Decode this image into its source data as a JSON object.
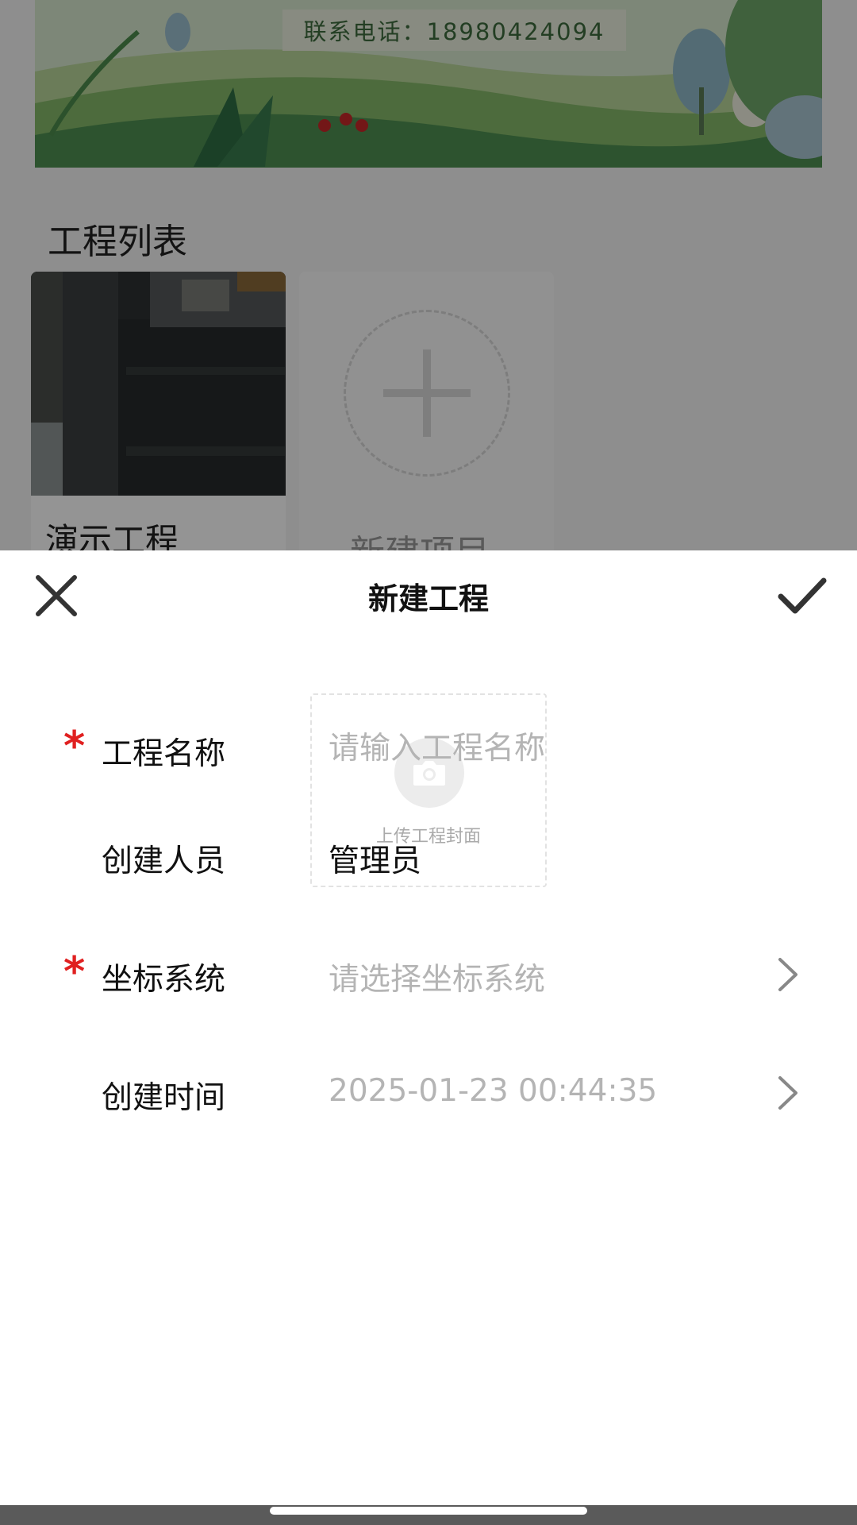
{
  "background": {
    "banner_phone": "联系电话：18980424094",
    "section_title": "工程列表",
    "projects": [
      {
        "name": "演示工程"
      }
    ],
    "new_project_label": "新建项目"
  },
  "sheet": {
    "title": "新建工程",
    "close_icon": "close-icon",
    "confirm_icon": "check-icon",
    "upload": {
      "label": "上传工程封面",
      "icon": "camera-icon"
    },
    "fields": {
      "project_name": {
        "label": "工程名称",
        "required": true,
        "placeholder": "请输入工程名称",
        "value": ""
      },
      "creator": {
        "label": "创建人员",
        "required": false,
        "value": "管理员"
      },
      "coordinate_system": {
        "label": "坐标系统",
        "required": true,
        "placeholder": "请选择坐标系统"
      },
      "created_time": {
        "label": "创建时间",
        "required": false,
        "value": "2025-01-23 00:44:35"
      }
    },
    "required_marker": "*"
  },
  "colors": {
    "required": "#e02020",
    "placeholder": "#b4b4b4",
    "overlay": "rgba(0,0,0,0.42)"
  }
}
